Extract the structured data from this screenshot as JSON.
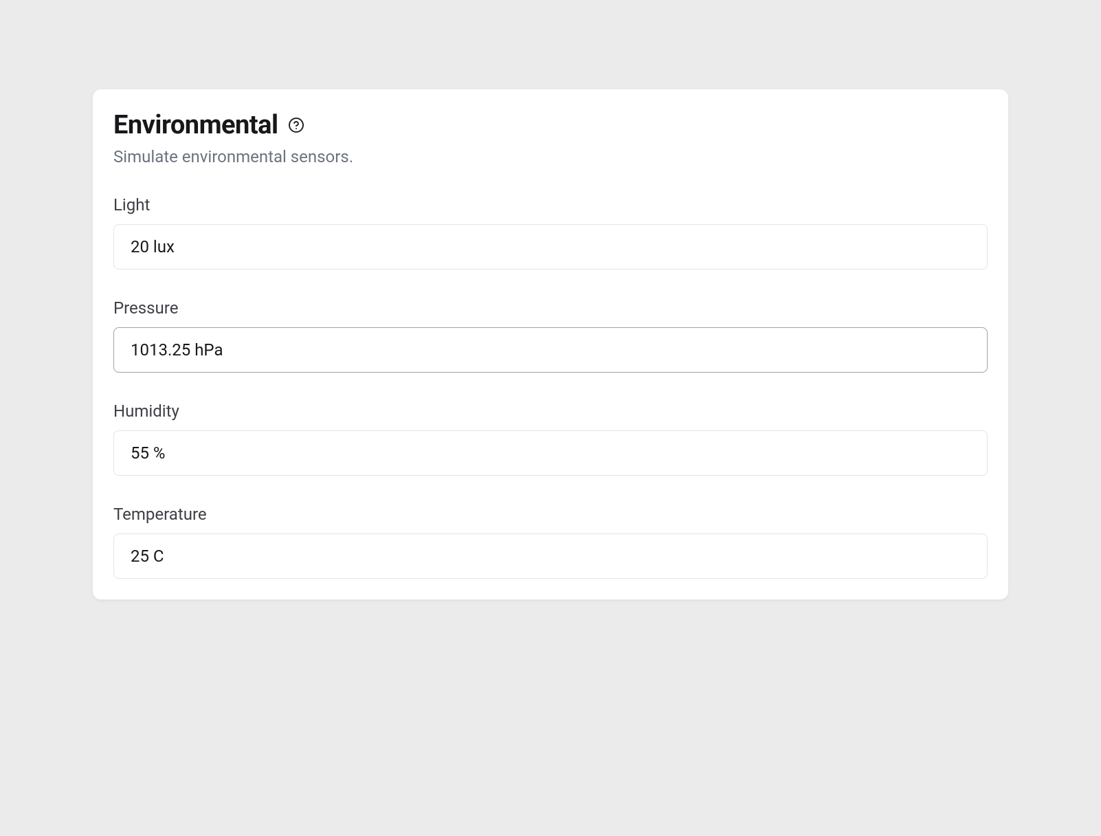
{
  "card": {
    "title": "Environmental",
    "subtitle": "Simulate environmental sensors."
  },
  "fields": {
    "light": {
      "label": "Light",
      "value": "20 lux"
    },
    "pressure": {
      "label": "Pressure",
      "value": "1013.25 hPa"
    },
    "humidity": {
      "label": "Humidity",
      "value": "55 %"
    },
    "temperature": {
      "label": "Temperature",
      "value": "25 C"
    }
  }
}
